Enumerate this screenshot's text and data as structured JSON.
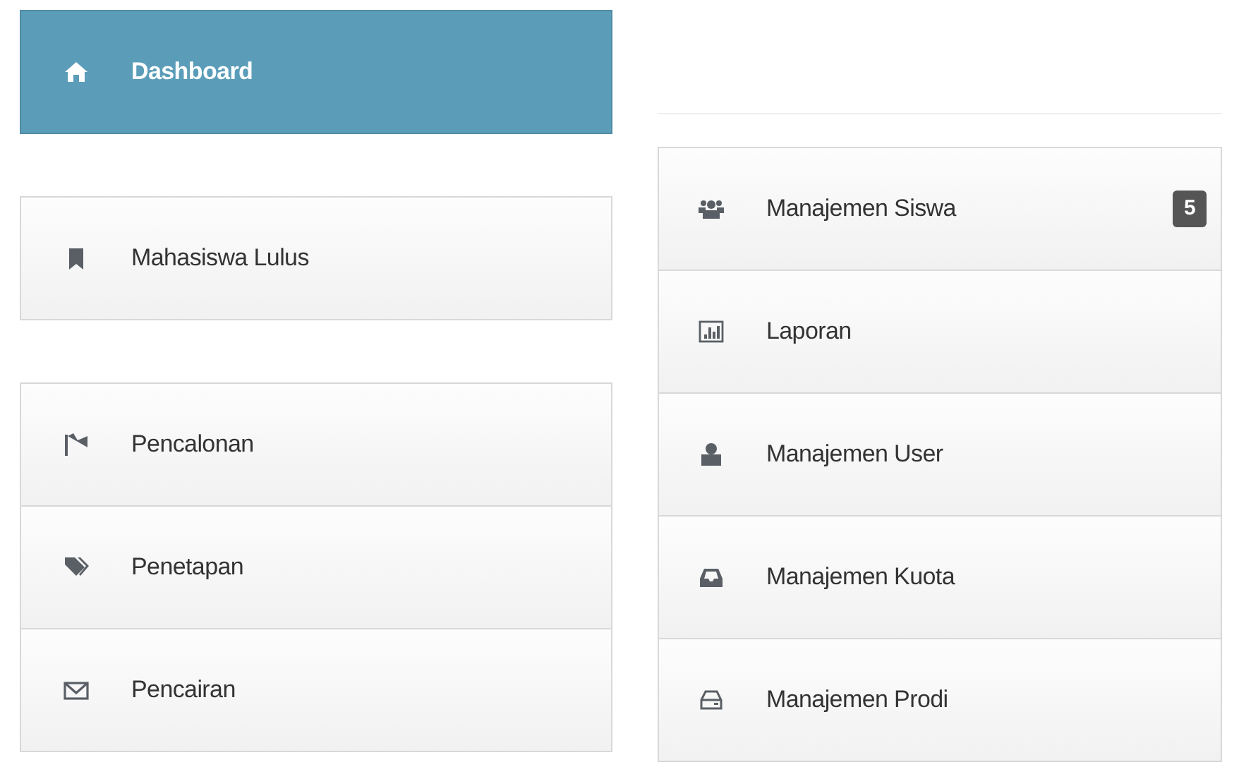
{
  "left_menu": {
    "groups": [
      {
        "items": [
          {
            "label": "Dashboard",
            "selected": true
          }
        ]
      },
      {
        "items": [
          {
            "label": "Mahasiswa Lulus",
            "selected": false
          }
        ]
      },
      {
        "items": [
          {
            "label": "Pencalonan",
            "selected": false
          },
          {
            "label": "Penetapan",
            "selected": false
          },
          {
            "label": "Pencairan",
            "selected": false
          }
        ]
      }
    ]
  },
  "right_menu": {
    "items": [
      {
        "label": "Manajemen Siswa",
        "badge": "5",
        "selected": false
      },
      {
        "label": "Laporan",
        "selected": false
      },
      {
        "label": "Manajemen User",
        "selected": false
      },
      {
        "label": "Manajemen Kuota",
        "selected": false
      },
      {
        "label": "Manajemen Prodi",
        "selected": false
      }
    ]
  }
}
